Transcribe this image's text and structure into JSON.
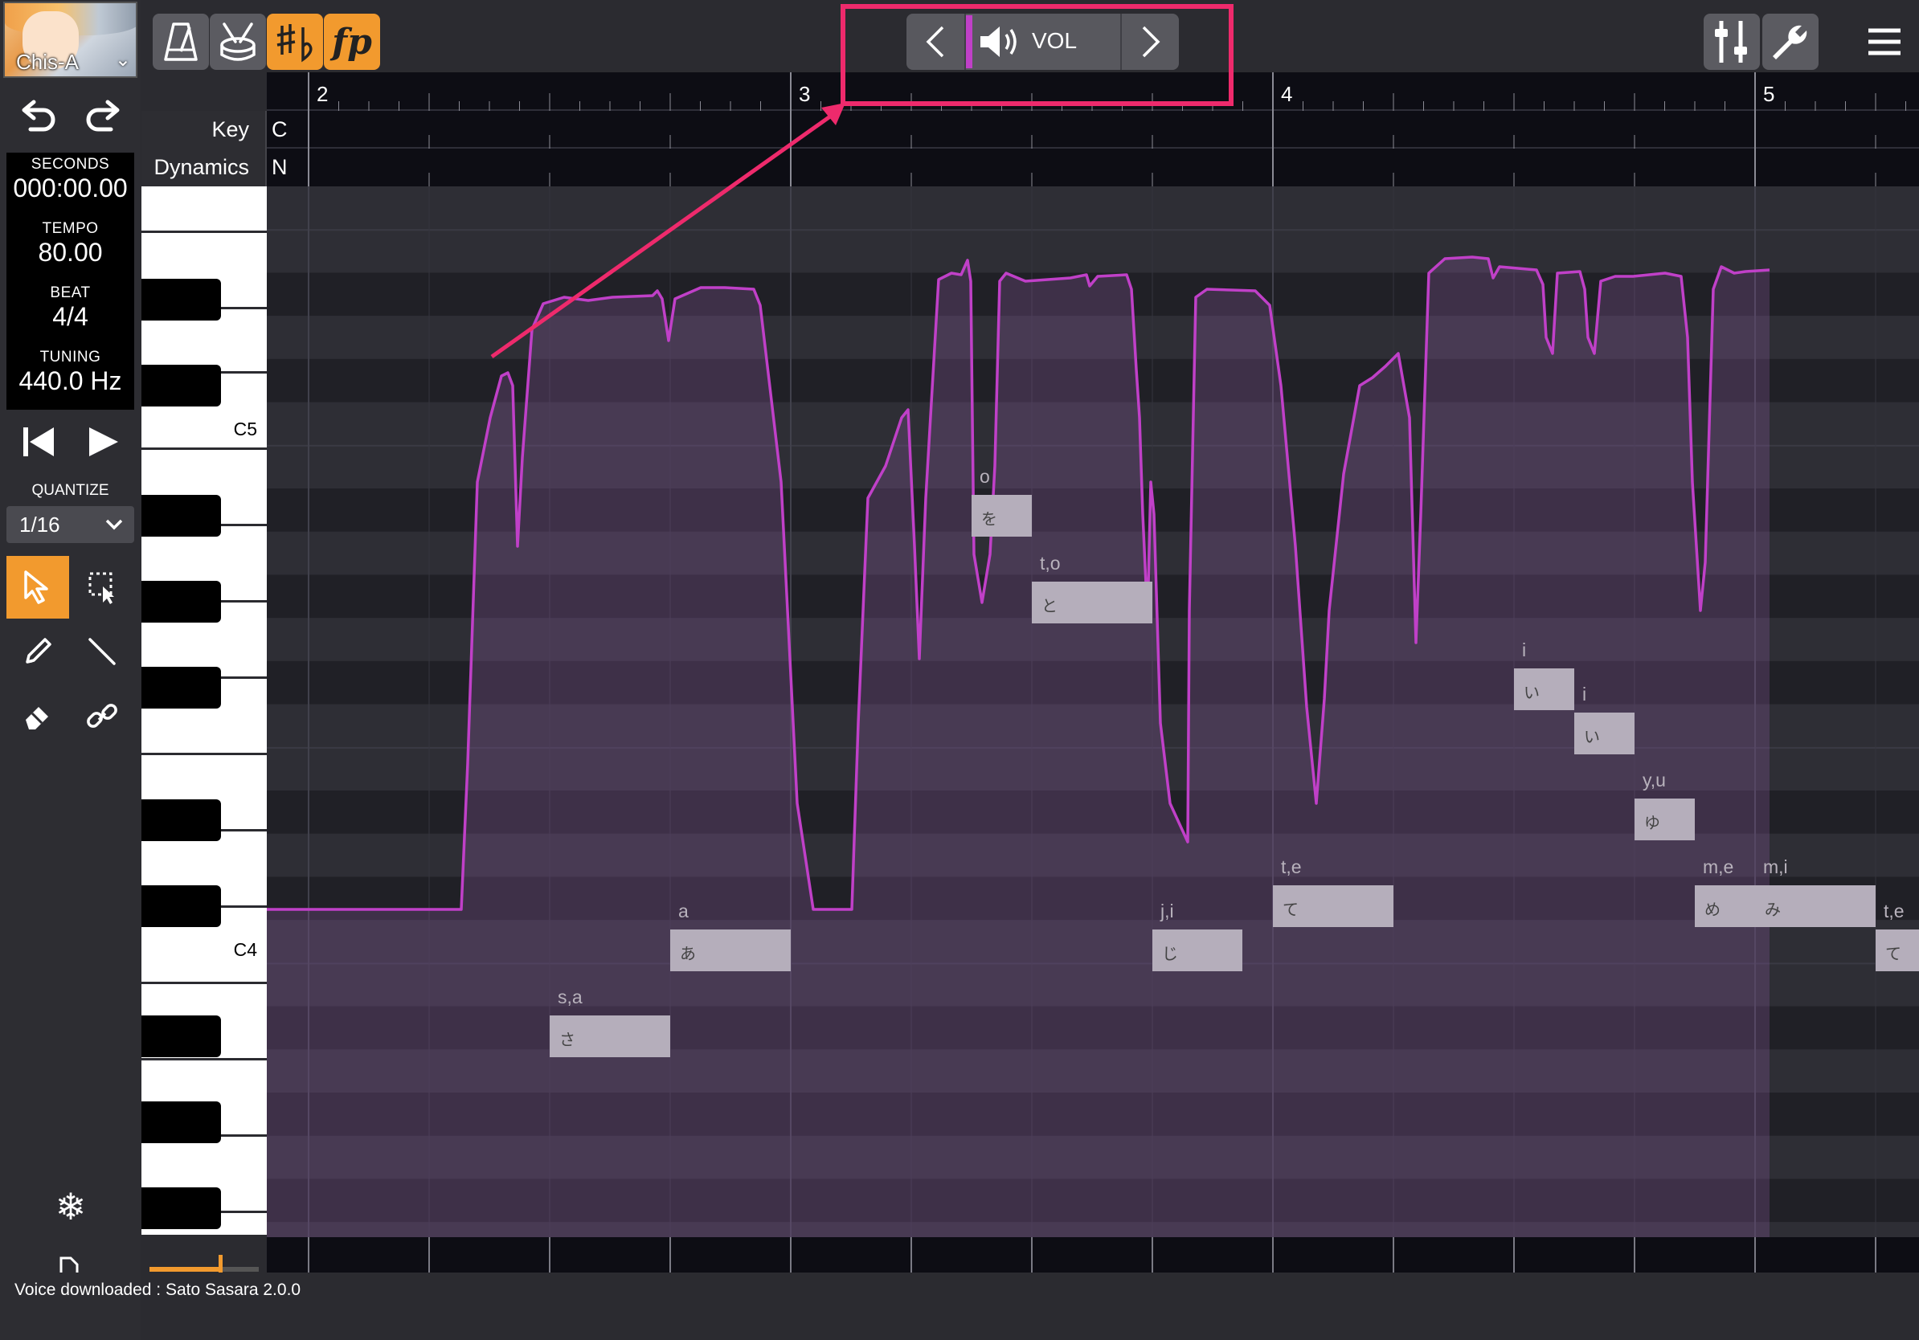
{
  "singer": {
    "name": "Chis-A"
  },
  "readouts": [
    {
      "label": "SECONDS",
      "value": "000:00.00"
    },
    {
      "label": "TEMPO",
      "value": "80.00"
    },
    {
      "label": "BEAT",
      "value": "4/4"
    },
    {
      "label": "TUNING",
      "value": "440.0 Hz"
    }
  ],
  "quantize": {
    "label": "QUANTIZE",
    "value": "1/16"
  },
  "param_nav": {
    "label": "VOL"
  },
  "rows": {
    "key_label": "Key",
    "key_value": "C",
    "dynamics_label": "Dynamics",
    "dynamics_value": "N"
  },
  "bars": [
    "2",
    "3",
    "4",
    "5"
  ],
  "octave_labels": {
    "c5": "C5",
    "c4": "C4"
  },
  "status": "Voice downloaded : Sato Sasara 2.0.0",
  "notes": [
    {
      "lyric": "s,a",
      "kana": "さ"
    },
    {
      "lyric": "a",
      "kana": "あ"
    },
    {
      "lyric": "o",
      "kana": "を"
    },
    {
      "lyric": "t,o",
      "kana": "と"
    },
    {
      "lyric": "j,i",
      "kana": "じ"
    },
    {
      "lyric": "t,e",
      "kana": "て"
    },
    {
      "lyric": "i",
      "kana": "い"
    },
    {
      "lyric": "i",
      "kana": "い"
    },
    {
      "lyric": "y,u",
      "kana": "ゆ"
    },
    {
      "lyric": "m,e",
      "kana": "め"
    },
    {
      "lyric": "m,i",
      "kana": "み"
    },
    {
      "lyric": "t,e",
      "kana": "て"
    }
  ],
  "colors": {
    "accent": "#f29a2e",
    "pitch_curve": "#c040c8",
    "highlight": "#ee2a6c",
    "note": "#b5aebb"
  },
  "icons": [
    "metronome-icon",
    "drum-icon",
    "sharp-flat-icon",
    "forte-piano-icon",
    "mixer-icon",
    "wrench-icon",
    "menu-icon",
    "undo-icon",
    "redo-icon",
    "rewind-icon",
    "play-icon",
    "pointer-icon",
    "box-select-icon",
    "pencil-icon",
    "line-icon",
    "eraser-icon",
    "link-icon",
    "snowflake-icon",
    "speaker-icon"
  ]
}
